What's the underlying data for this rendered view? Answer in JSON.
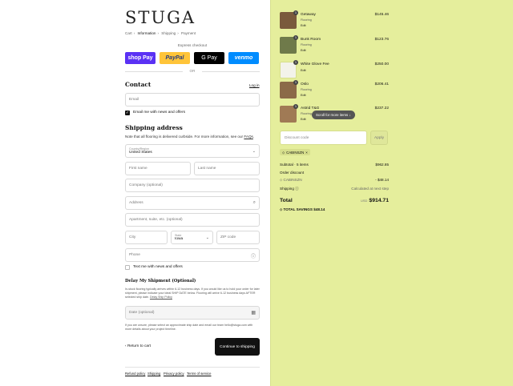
{
  "brand": {
    "logo": "STUGA"
  },
  "breadcrumbs": [
    "Cart",
    "Information",
    "Shipping",
    "Payment"
  ],
  "express": {
    "label": "Express checkout",
    "buttons": [
      "shop Pay",
      "PayPal",
      "G Pay",
      "venmo"
    ],
    "or": "OR"
  },
  "contact": {
    "title": "Contact",
    "login": "Log in",
    "email_placeholder": "Email",
    "news_label": "Email me with news and offers"
  },
  "shipping": {
    "title": "Shipping address",
    "note": "Note that all flooring is delivered curbside. For more information, see our",
    "note_link": "FAQs",
    "country_label": "Country/Region",
    "country_value": "United States",
    "first_name": "First name",
    "last_name": "Last name",
    "company": "Company (optional)",
    "address": "Address",
    "apartment": "Apartment, suite, etc. (optional)",
    "city": "City",
    "state_label": "State",
    "state_value": "Iowa",
    "zip": "ZIP code",
    "phone": "Phone",
    "text_label": "Text me with news and offers"
  },
  "delay": {
    "title": "Delay My Shipment (Optional)",
    "text": "In-stock flooring typically arrives within 6-12 business days. If you would like us to hold your order for later shipment, please indicate your ideal SHIP DATE below. Flooring will arrive 6-12 business days AFTER selected ship date.",
    "policy_link": "Delay Ship Policy",
    "date_placeholder": "Date (optional)",
    "footnote": "If you are unsure, please select an approximate ship date and email our team hello@stuga.com with more details about your project timeline."
  },
  "actions": {
    "back": "Return to cart",
    "continue": "Continue to shipping"
  },
  "footer_links": [
    "Refund policy",
    "Shipping",
    "Privacy policy",
    "Terms of service"
  ],
  "order": {
    "items": [
      {
        "name": "Getaway",
        "sub": "Flooring",
        "edit": "Edit",
        "price": "$145.46",
        "qty": "1",
        "color": "#7a5a3c"
      },
      {
        "name": "Bunk Room",
        "sub": "Flooring",
        "edit": "Edit",
        "price": "$123.76",
        "qty": "1",
        "color": "#6f7a4a"
      },
      {
        "name": "White Glove Fee",
        "sub": "",
        "edit": "Edit",
        "price": "$250.00",
        "qty": "1",
        "color": "#f3f3ea"
      },
      {
        "name": "Oslo",
        "sub": "Flooring",
        "edit": "Edit",
        "price": "$206.41",
        "qty": "1",
        "color": "#8b6a48"
      },
      {
        "name": "Astrid T&G",
        "sub": "Flooring",
        "edit": "Edit",
        "price": "$237.22",
        "qty": "1",
        "color": "#a07a55"
      }
    ],
    "scroll_hint": "Scroll for more items",
    "discount_placeholder": "Discount code",
    "apply": "Apply",
    "applied_code": "CABINSZN",
    "subtotal_label": "Subtotal · 5 items",
    "subtotal_value": "$962.85",
    "order_discount_label": "Order discount",
    "order_discount_code": "CABINSZN",
    "order_discount_value": "- $48.14",
    "shipping_label": "Shipping",
    "shipping_value": "Calculated at next step",
    "total_label": "Total",
    "currency": "USD",
    "total_value": "$914.71",
    "savings_label": "TOTAL SAVINGS",
    "savings_value": "$48.14"
  }
}
